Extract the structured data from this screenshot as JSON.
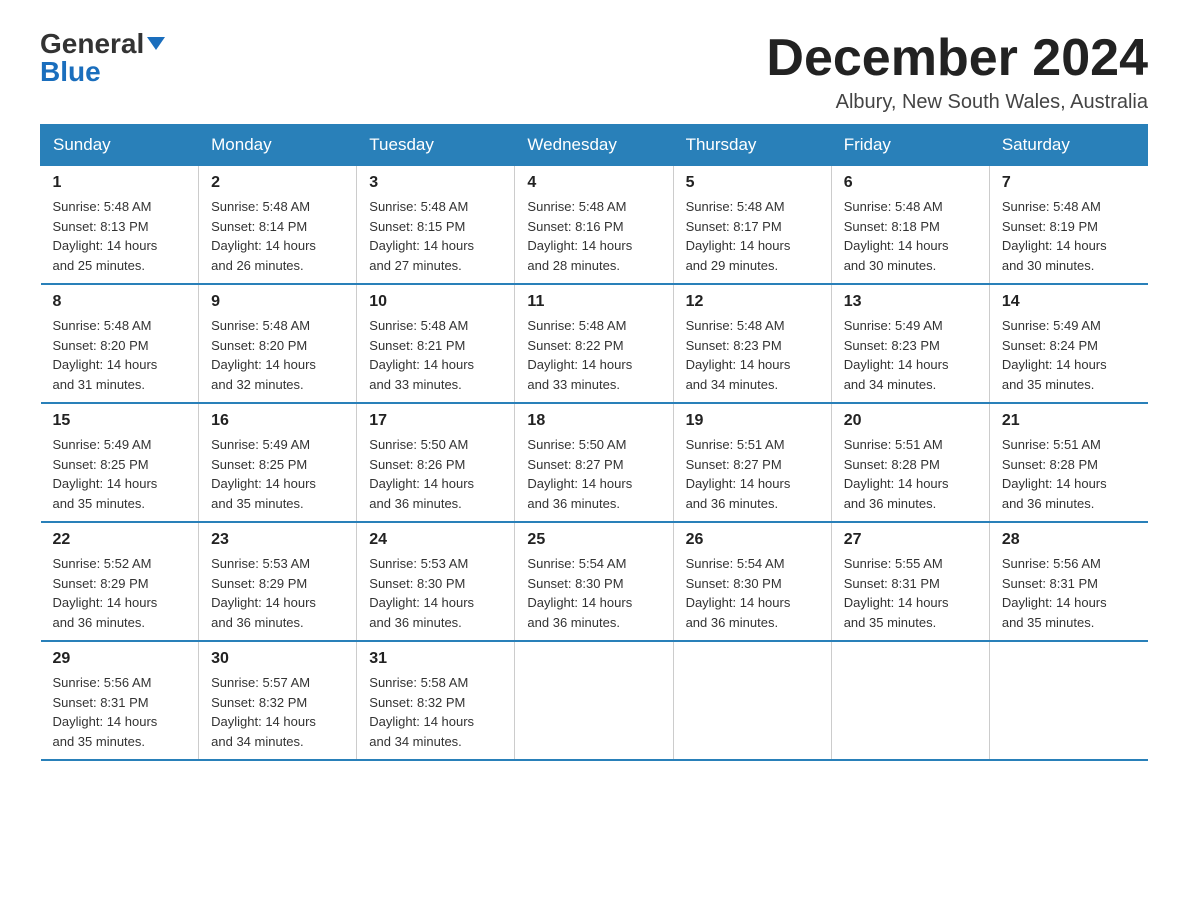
{
  "logo": {
    "part1": "General",
    "part2": "Blue"
  },
  "header": {
    "month_year": "December 2024",
    "location": "Albury, New South Wales, Australia"
  },
  "weekdays": [
    "Sunday",
    "Monday",
    "Tuesday",
    "Wednesday",
    "Thursday",
    "Friday",
    "Saturday"
  ],
  "weeks": [
    [
      {
        "day": "1",
        "sunrise": "5:48 AM",
        "sunset": "8:13 PM",
        "daylight": "14 hours and 25 minutes."
      },
      {
        "day": "2",
        "sunrise": "5:48 AM",
        "sunset": "8:14 PM",
        "daylight": "14 hours and 26 minutes."
      },
      {
        "day": "3",
        "sunrise": "5:48 AM",
        "sunset": "8:15 PM",
        "daylight": "14 hours and 27 minutes."
      },
      {
        "day": "4",
        "sunrise": "5:48 AM",
        "sunset": "8:16 PM",
        "daylight": "14 hours and 28 minutes."
      },
      {
        "day": "5",
        "sunrise": "5:48 AM",
        "sunset": "8:17 PM",
        "daylight": "14 hours and 29 minutes."
      },
      {
        "day": "6",
        "sunrise": "5:48 AM",
        "sunset": "8:18 PM",
        "daylight": "14 hours and 30 minutes."
      },
      {
        "day": "7",
        "sunrise": "5:48 AM",
        "sunset": "8:19 PM",
        "daylight": "14 hours and 30 minutes."
      }
    ],
    [
      {
        "day": "8",
        "sunrise": "5:48 AM",
        "sunset": "8:20 PM",
        "daylight": "14 hours and 31 minutes."
      },
      {
        "day": "9",
        "sunrise": "5:48 AM",
        "sunset": "8:20 PM",
        "daylight": "14 hours and 32 minutes."
      },
      {
        "day": "10",
        "sunrise": "5:48 AM",
        "sunset": "8:21 PM",
        "daylight": "14 hours and 33 minutes."
      },
      {
        "day": "11",
        "sunrise": "5:48 AM",
        "sunset": "8:22 PM",
        "daylight": "14 hours and 33 minutes."
      },
      {
        "day": "12",
        "sunrise": "5:48 AM",
        "sunset": "8:23 PM",
        "daylight": "14 hours and 34 minutes."
      },
      {
        "day": "13",
        "sunrise": "5:49 AM",
        "sunset": "8:23 PM",
        "daylight": "14 hours and 34 minutes."
      },
      {
        "day": "14",
        "sunrise": "5:49 AM",
        "sunset": "8:24 PM",
        "daylight": "14 hours and 35 minutes."
      }
    ],
    [
      {
        "day": "15",
        "sunrise": "5:49 AM",
        "sunset": "8:25 PM",
        "daylight": "14 hours and 35 minutes."
      },
      {
        "day": "16",
        "sunrise": "5:49 AM",
        "sunset": "8:25 PM",
        "daylight": "14 hours and 35 minutes."
      },
      {
        "day": "17",
        "sunrise": "5:50 AM",
        "sunset": "8:26 PM",
        "daylight": "14 hours and 36 minutes."
      },
      {
        "day": "18",
        "sunrise": "5:50 AM",
        "sunset": "8:27 PM",
        "daylight": "14 hours and 36 minutes."
      },
      {
        "day": "19",
        "sunrise": "5:51 AM",
        "sunset": "8:27 PM",
        "daylight": "14 hours and 36 minutes."
      },
      {
        "day": "20",
        "sunrise": "5:51 AM",
        "sunset": "8:28 PM",
        "daylight": "14 hours and 36 minutes."
      },
      {
        "day": "21",
        "sunrise": "5:51 AM",
        "sunset": "8:28 PM",
        "daylight": "14 hours and 36 minutes."
      }
    ],
    [
      {
        "day": "22",
        "sunrise": "5:52 AM",
        "sunset": "8:29 PM",
        "daylight": "14 hours and 36 minutes."
      },
      {
        "day": "23",
        "sunrise": "5:53 AM",
        "sunset": "8:29 PM",
        "daylight": "14 hours and 36 minutes."
      },
      {
        "day": "24",
        "sunrise": "5:53 AM",
        "sunset": "8:30 PM",
        "daylight": "14 hours and 36 minutes."
      },
      {
        "day": "25",
        "sunrise": "5:54 AM",
        "sunset": "8:30 PM",
        "daylight": "14 hours and 36 minutes."
      },
      {
        "day": "26",
        "sunrise": "5:54 AM",
        "sunset": "8:30 PM",
        "daylight": "14 hours and 36 minutes."
      },
      {
        "day": "27",
        "sunrise": "5:55 AM",
        "sunset": "8:31 PM",
        "daylight": "14 hours and 35 minutes."
      },
      {
        "day": "28",
        "sunrise": "5:56 AM",
        "sunset": "8:31 PM",
        "daylight": "14 hours and 35 minutes."
      }
    ],
    [
      {
        "day": "29",
        "sunrise": "5:56 AM",
        "sunset": "8:31 PM",
        "daylight": "14 hours and 35 minutes."
      },
      {
        "day": "30",
        "sunrise": "5:57 AM",
        "sunset": "8:32 PM",
        "daylight": "14 hours and 34 minutes."
      },
      {
        "day": "31",
        "sunrise": "5:58 AM",
        "sunset": "8:32 PM",
        "daylight": "14 hours and 34 minutes."
      },
      null,
      null,
      null,
      null
    ]
  ],
  "labels": {
    "sunrise": "Sunrise:",
    "sunset": "Sunset:",
    "daylight": "Daylight:"
  }
}
